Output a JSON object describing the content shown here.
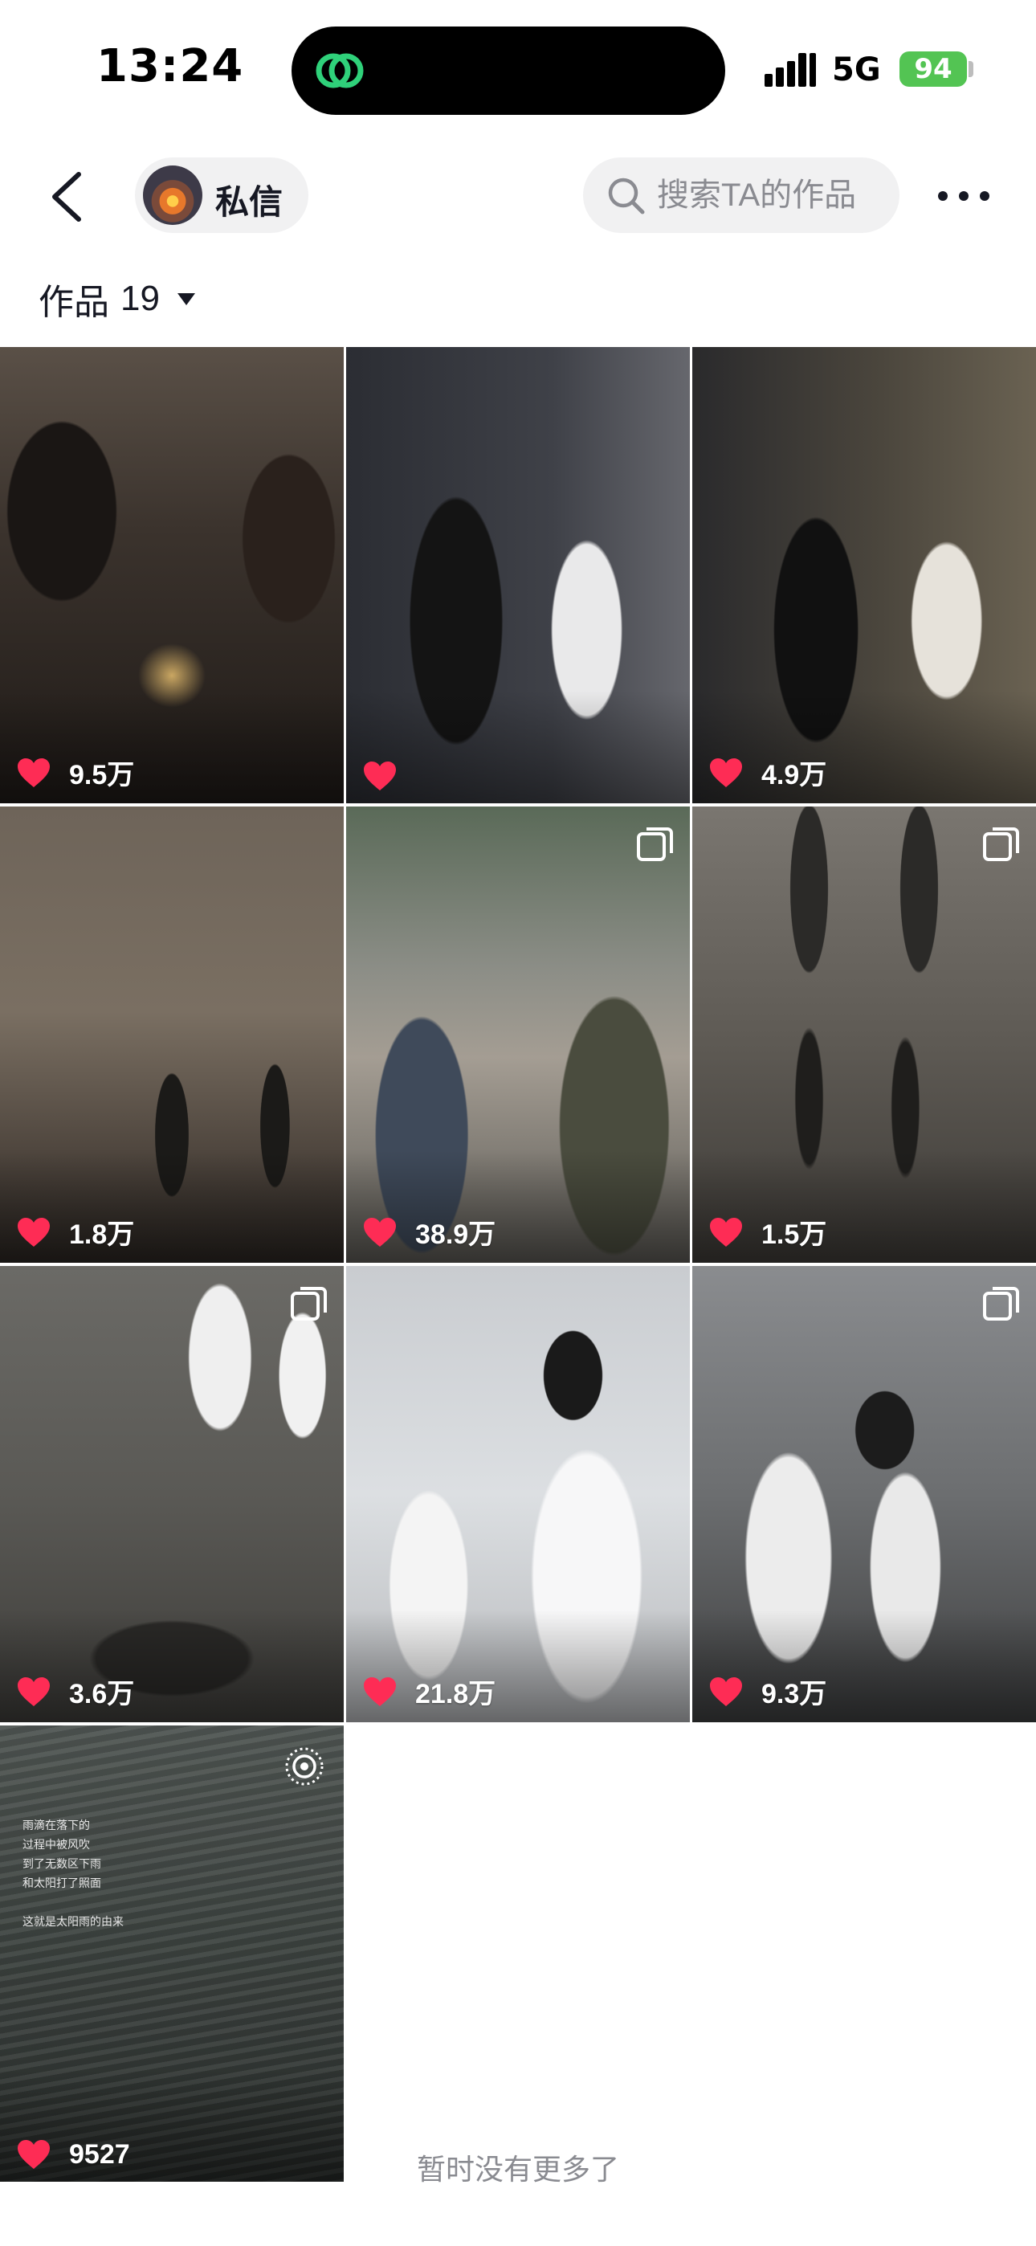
{
  "status_bar": {
    "time": "13:24",
    "network": "5G",
    "battery": "94"
  },
  "header": {
    "dm_label": "私信",
    "search_placeholder": "搜索TA的作品"
  },
  "works": {
    "label": "作品",
    "count": "19"
  },
  "tiles": [
    {
      "likes": "9.5万",
      "multi": false,
      "live": false,
      "scene": "candle couple, dark room"
    },
    {
      "likes": "",
      "multi": false,
      "live": false,
      "scene": "couple night street"
    },
    {
      "likes": "4.9万",
      "multi": false,
      "live": false,
      "scene": "couple by stone wall at night"
    },
    {
      "likes": "1.8万",
      "multi": false,
      "live": false,
      "scene": "silhouettes at dusk"
    },
    {
      "likes": "38.9万",
      "multi": true,
      "live": false,
      "scene": "couple with city buildings"
    },
    {
      "likes": "1.5万",
      "multi": true,
      "live": false,
      "scene": "reflections on wet ground"
    },
    {
      "likes": "3.6万",
      "multi": true,
      "live": false,
      "scene": "couple walking in rain"
    },
    {
      "likes": "21.8万",
      "multi": false,
      "live": false,
      "scene": "couple in white shirts by window"
    },
    {
      "likes": "9.3万",
      "multi": true,
      "live": false,
      "scene": "couple on rooftop"
    },
    {
      "likes": "9527",
      "multi": false,
      "live": true,
      "scene": "rain on water surface"
    }
  ],
  "tile_caption": [
    "雨滴在落下的",
    "过程中被风吹",
    "到了无数区下雨",
    "和太阳打了照面",
    "",
    "这就是太阳雨的由来"
  ],
  "footer": {
    "no_more": "暂时没有更多了"
  },
  "colors": {
    "heart": "#fe2c55",
    "battery": "#53c453",
    "pill_bg": "#f1f1f2"
  }
}
